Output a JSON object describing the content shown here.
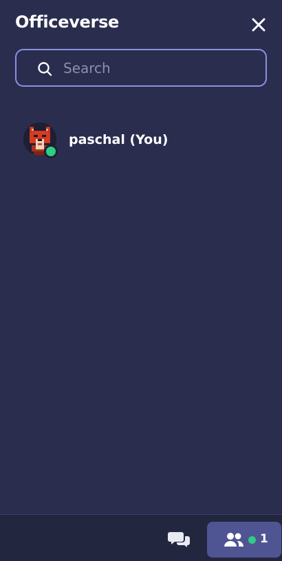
{
  "header": {
    "title": "Officeverse",
    "close_icon": "close-icon"
  },
  "search": {
    "placeholder": "Search",
    "value": "",
    "icon": "search-icon"
  },
  "users": [
    {
      "name": "paschal (You)",
      "status": "online",
      "avatar": "fox-avatar"
    }
  ],
  "footer": {
    "chat_icon": "chat-bubbles-icon",
    "people_icon": "people-icon",
    "online_count": "1"
  },
  "colors": {
    "background": "#2a2d4e",
    "accent_border": "#8b92e0",
    "online": "#2ecc85",
    "active_tab": "#4f5592"
  }
}
